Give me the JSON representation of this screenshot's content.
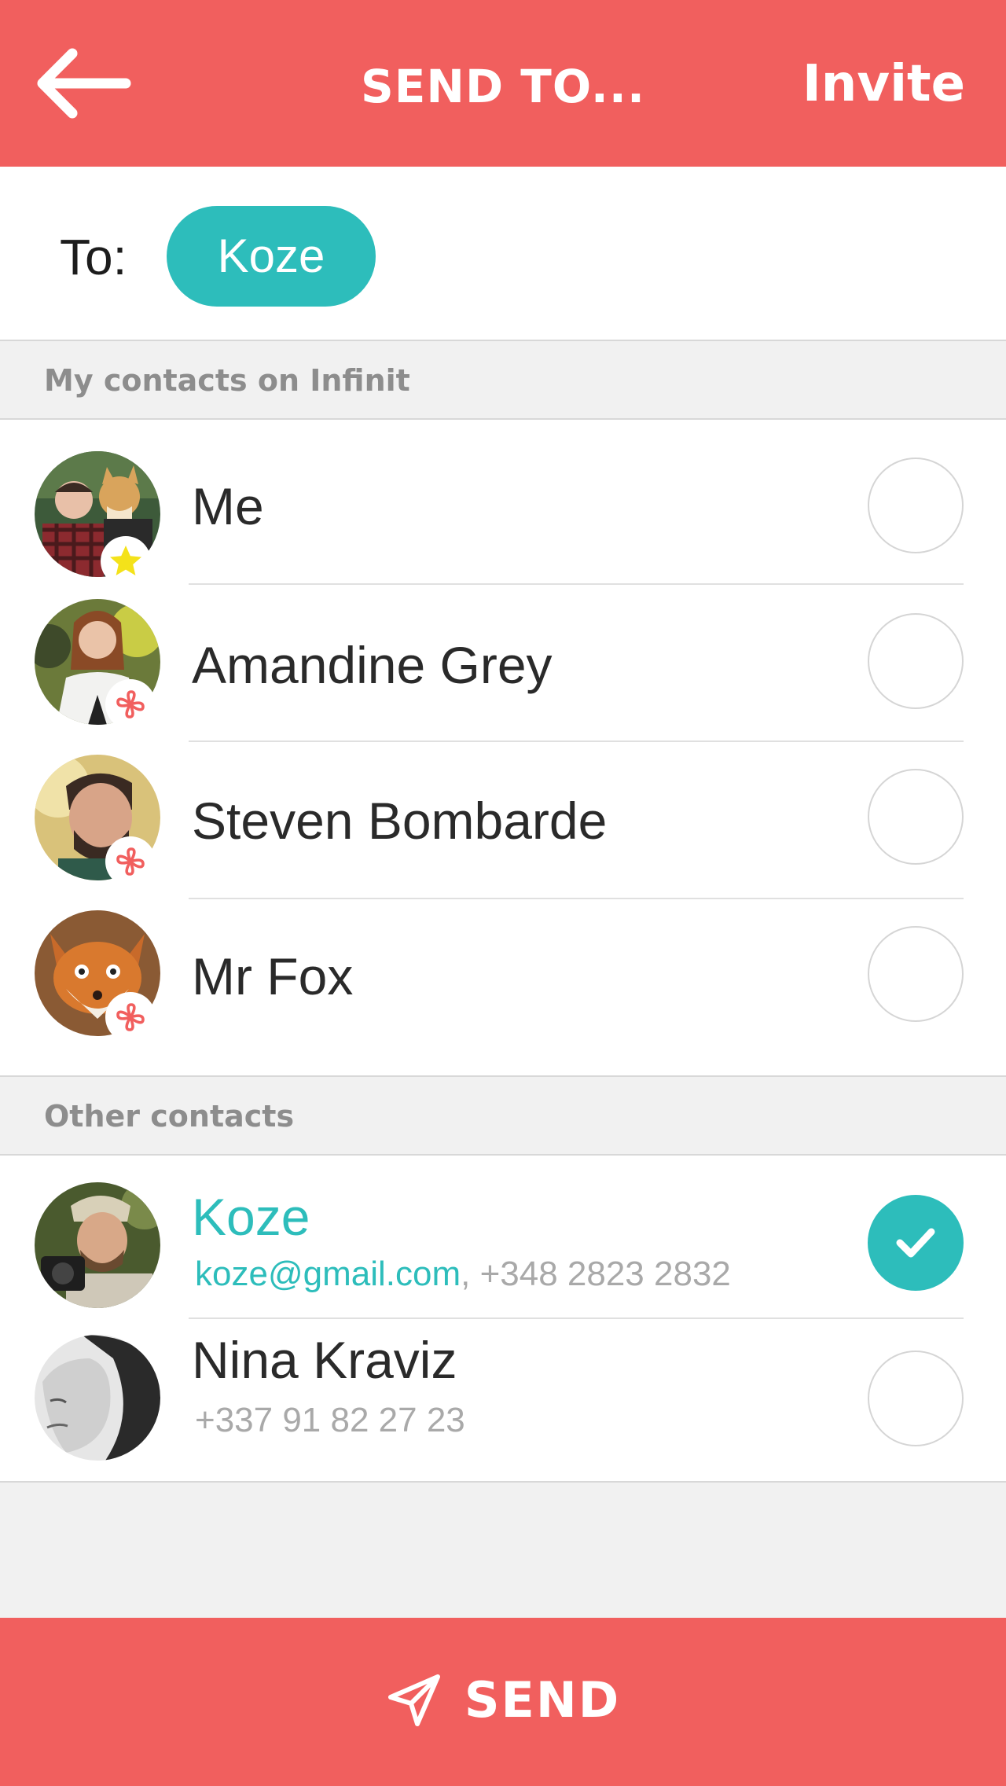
{
  "header": {
    "title": "SEND TO...",
    "invite_label": "Invite"
  },
  "to_row": {
    "label": "To:",
    "recipients": [
      "Koze"
    ]
  },
  "sections": {
    "infinit": "My contacts on Infinit",
    "other": "Other contacts"
  },
  "infinit_contacts": [
    {
      "name": "Me",
      "badge": "star-icon",
      "selected": false
    },
    {
      "name": "Amandine Grey",
      "badge": "infinit-icon",
      "selected": false
    },
    {
      "name": "Steven Bombarde",
      "badge": "infinit-icon",
      "selected": false
    },
    {
      "name": "Mr Fox",
      "badge": "infinit-icon",
      "selected": false
    }
  ],
  "other_contacts": [
    {
      "name": "Koze",
      "email": "koze@gmail.com",
      "separator": ", ",
      "phone": "+348 2823 2832",
      "selected": true
    },
    {
      "name": "Nina Kraviz",
      "phone": "+337 91 82 27 23",
      "selected": false
    }
  ],
  "send": {
    "label": "SEND"
  },
  "colors": {
    "accent": "#f15f5e",
    "teal": "#2dbdbb",
    "badge_star": "#f4e21a"
  }
}
